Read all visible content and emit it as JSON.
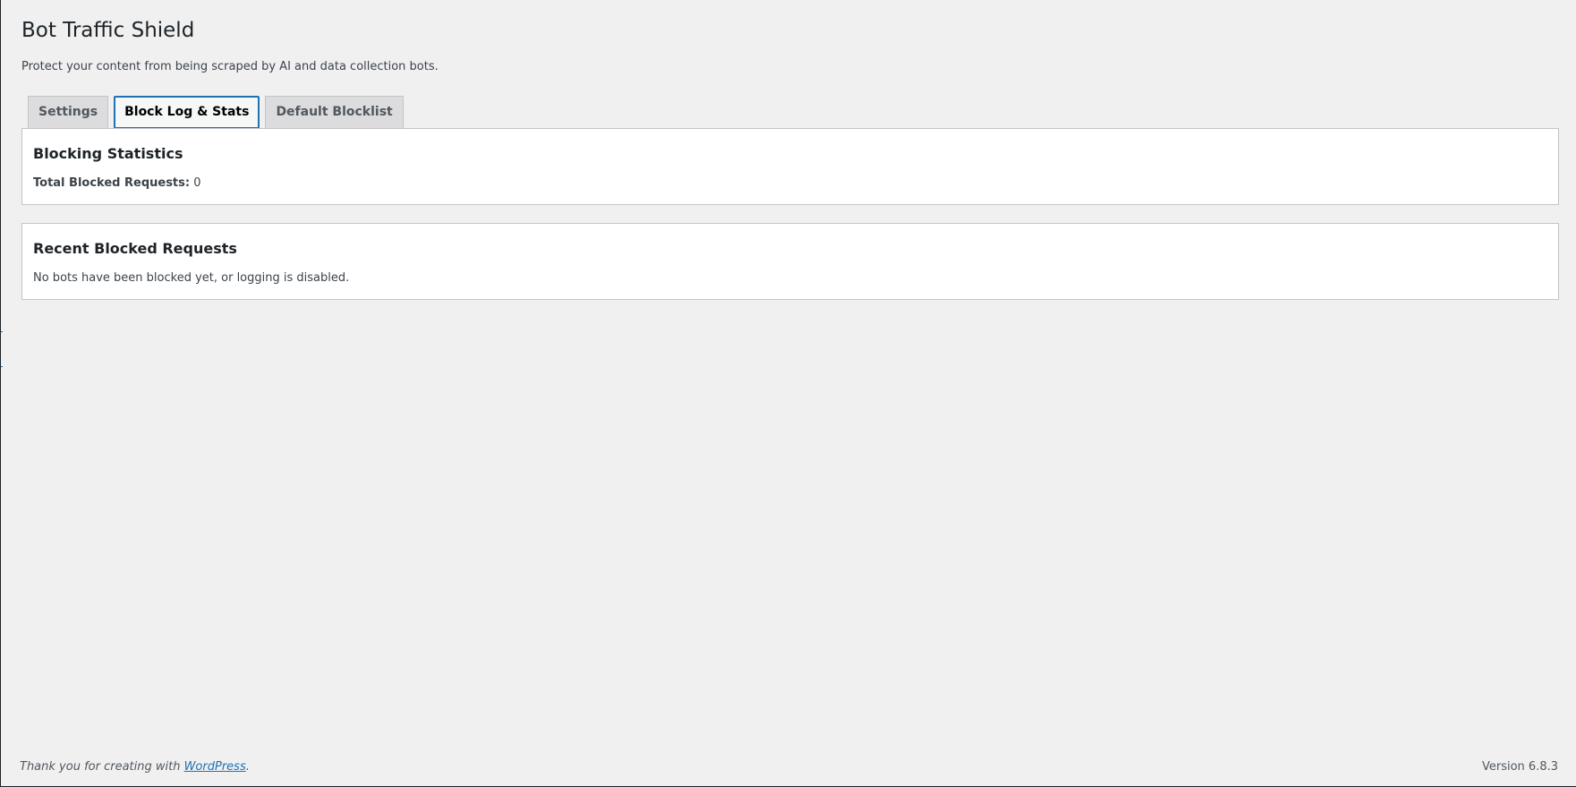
{
  "header": {
    "title": "Bot Traffic Shield",
    "description": "Protect your content from being scraped by AI and data collection bots."
  },
  "tabs": [
    {
      "label": "Settings",
      "active": false
    },
    {
      "label": "Block Log & Stats",
      "active": true
    },
    {
      "label": "Default Blocklist",
      "active": false
    }
  ],
  "stats": {
    "heading": "Blocking Statistics",
    "total_label": "Total Blocked Requests:",
    "total_value": "0"
  },
  "recent": {
    "heading": "Recent Blocked Requests",
    "empty_message": "No bots have been blocked yet, or logging is disabled."
  },
  "footer": {
    "thanks_prefix": "Thank you for creating with ",
    "thanks_link": "WordPress",
    "thanks_suffix": ".",
    "version": "Version 6.8.3"
  },
  "colors": {
    "background": "#f0f0f1",
    "accent": "#2271b1",
    "card": "#ffffff",
    "border": "#c3c4c7"
  }
}
